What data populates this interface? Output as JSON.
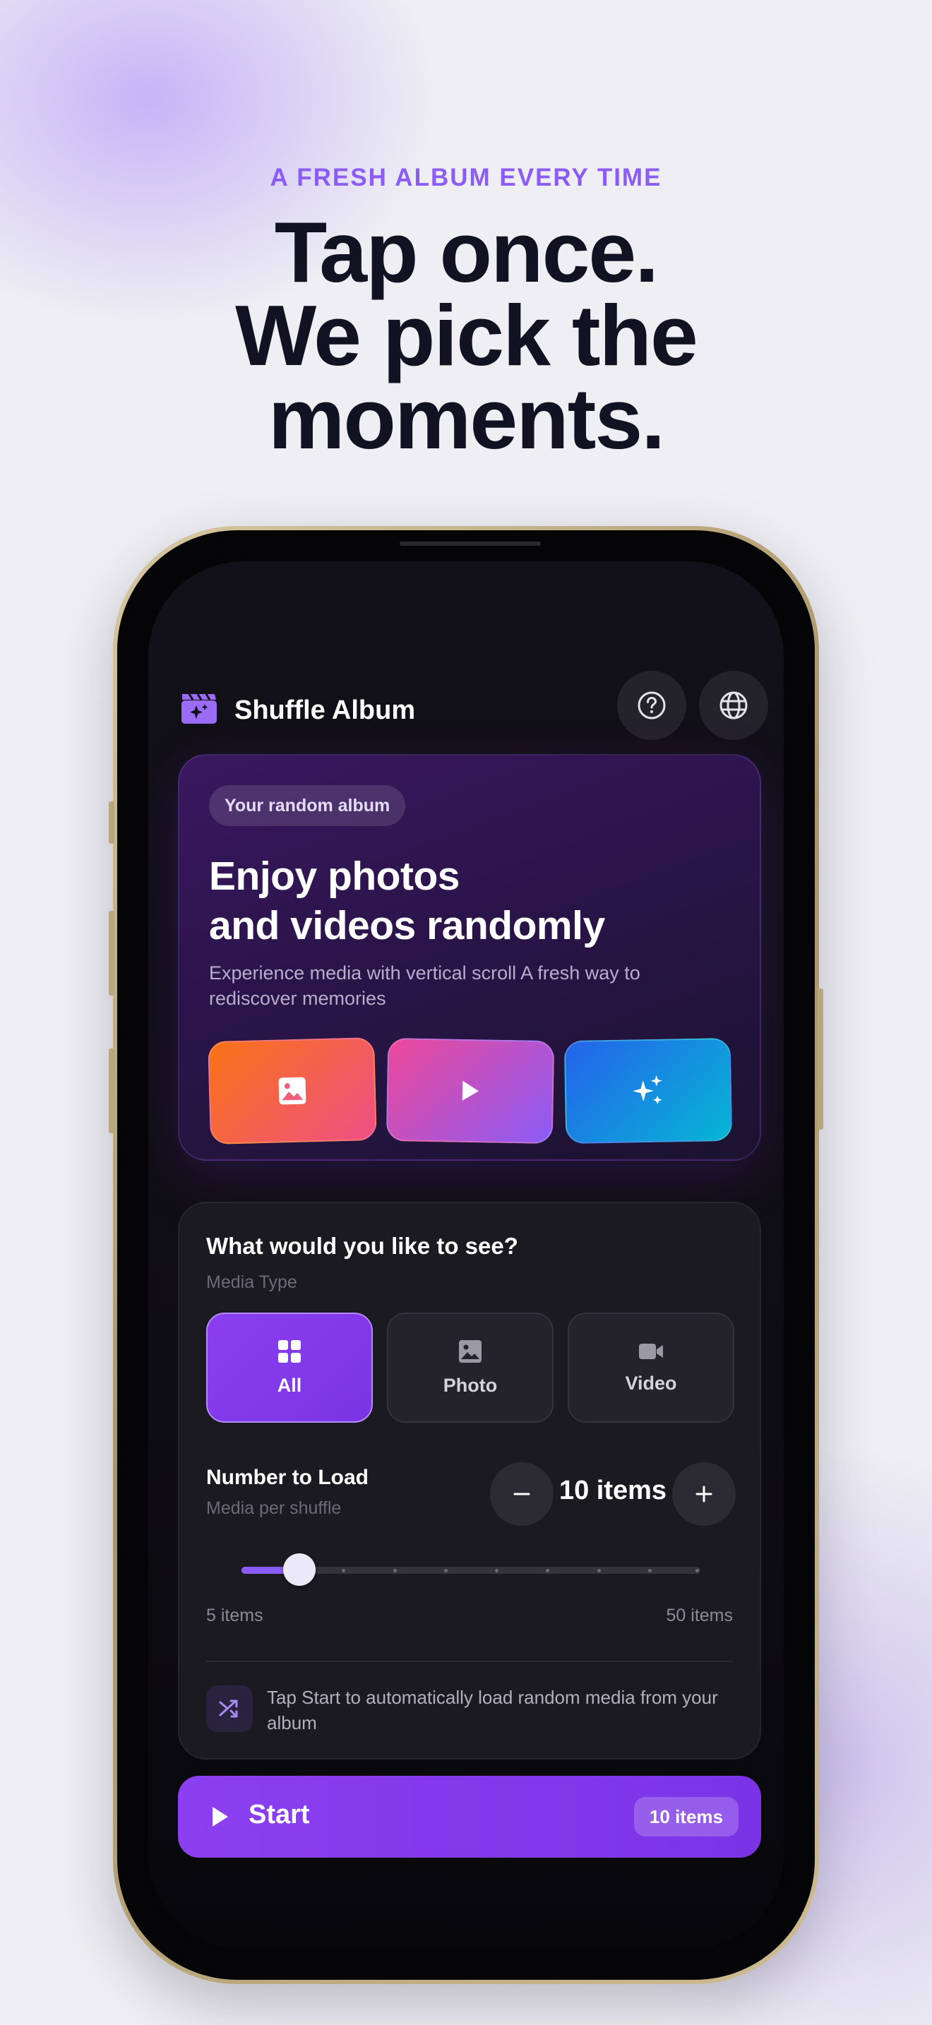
{
  "marketing": {
    "eyebrow": "A FRESH ALBUM EVERY TIME",
    "headline_lines": [
      "Tap once.",
      "We pick the",
      "moments."
    ]
  },
  "header": {
    "app_title": "Shuffle Album",
    "icons": [
      "clapperboard-sparkle-icon",
      "help-icon",
      "globe-icon"
    ]
  },
  "hero": {
    "pill": "Your random album",
    "title_lines": [
      "Enjoy photos",
      "and videos randomly"
    ],
    "description": "Experience media with vertical scroll A fresh way to rediscover memories",
    "tiles": [
      "image-icon",
      "play-icon",
      "sparkle-icon"
    ]
  },
  "options": {
    "question": "What would you like to see?",
    "media_type_label": "Media Type",
    "media_types": [
      {
        "label": "All",
        "icon": "grid-icon",
        "selected": true
      },
      {
        "label": "Photo",
        "icon": "image-icon",
        "selected": false
      },
      {
        "label": "Video",
        "icon": "video-icon",
        "selected": false
      }
    ],
    "number_label": "Number to Load",
    "number_sub": "Media per shuffle",
    "count_text": "10 items",
    "slider": {
      "min": 5,
      "max": 50,
      "value": 10,
      "min_label": "5 items",
      "max_label": "50 items"
    },
    "tip": "Tap Start to automatically load random media from your album"
  },
  "start": {
    "label": "Start",
    "badge": "10 items"
  },
  "colors": {
    "accent": "#8b5cf6",
    "start_button": "#7a34e6",
    "headline": "#111322"
  }
}
